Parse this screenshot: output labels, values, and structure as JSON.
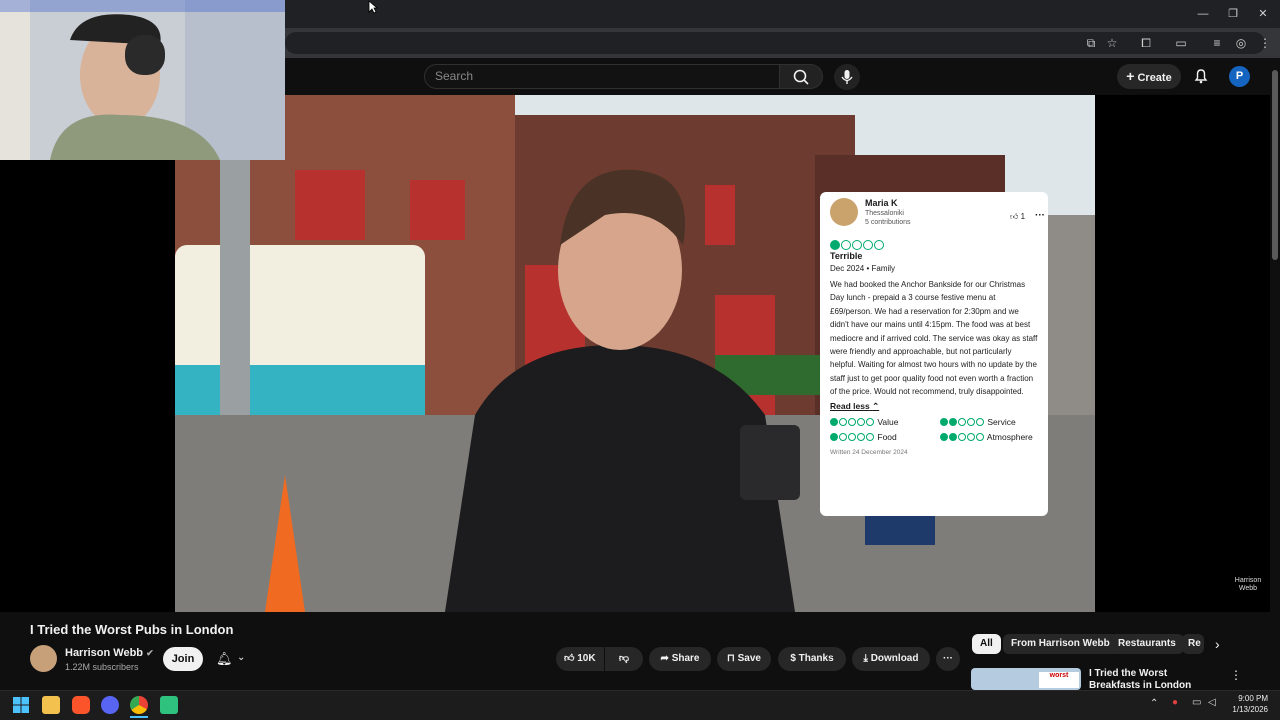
{
  "youtube": {
    "search_placeholder": "Search",
    "create_label": "Create",
    "avatar_letter": "P"
  },
  "video": {
    "title": "I Tried the Worst Pubs in London",
    "watermark": "Harrison Webb"
  },
  "review": {
    "author": "Maria K",
    "location": "Thessaloniki",
    "contributions": "5 contributions",
    "likes": "1",
    "rating_bubbles": 1,
    "rating_label": "Terrible",
    "date_type": "Dec 2024 • Family",
    "body": "We had booked the Anchor Bankside for our Christmas Day lunch - prepaid a 3 course festive menu at £69/person. We had a reservation for 2:30pm and we didn't have our mains until 4:15pm. The food was at best mediocre and if arrived cold. The service was okay as staff were friendly and approachable, but not particularly helpful. Waiting for almost two hours with no update by the staff just to get poor quality food not even worth a fraction of the price. Would not recommend, truly disappointed.",
    "read_less": "Read less",
    "sub_ratings": [
      {
        "label": "Value",
        "bubbles": 1
      },
      {
        "label": "Service",
        "bubbles": 2
      },
      {
        "label": "Food",
        "bubbles": 1
      },
      {
        "label": "Atmosphere",
        "bubbles": 2
      }
    ],
    "written": "Written 24 December 2024",
    "accent_color": "#00aa6c"
  },
  "channel": {
    "name": "Harrison Webb",
    "subscribers": "1.22M subscribers",
    "join_label": "Join"
  },
  "actions": {
    "likes": "10K",
    "share": "Share",
    "save": "Save",
    "thanks": "Thanks",
    "download": "Download"
  },
  "chips": [
    "All",
    "From Harrison Webb",
    "Restaurants",
    "Re"
  ],
  "related": {
    "title": "I Tried the Worst Breakfasts in London",
    "thumb_text": "worst"
  },
  "taskbar": {
    "time": "9:00 PM",
    "date": "1/13/2026"
  }
}
